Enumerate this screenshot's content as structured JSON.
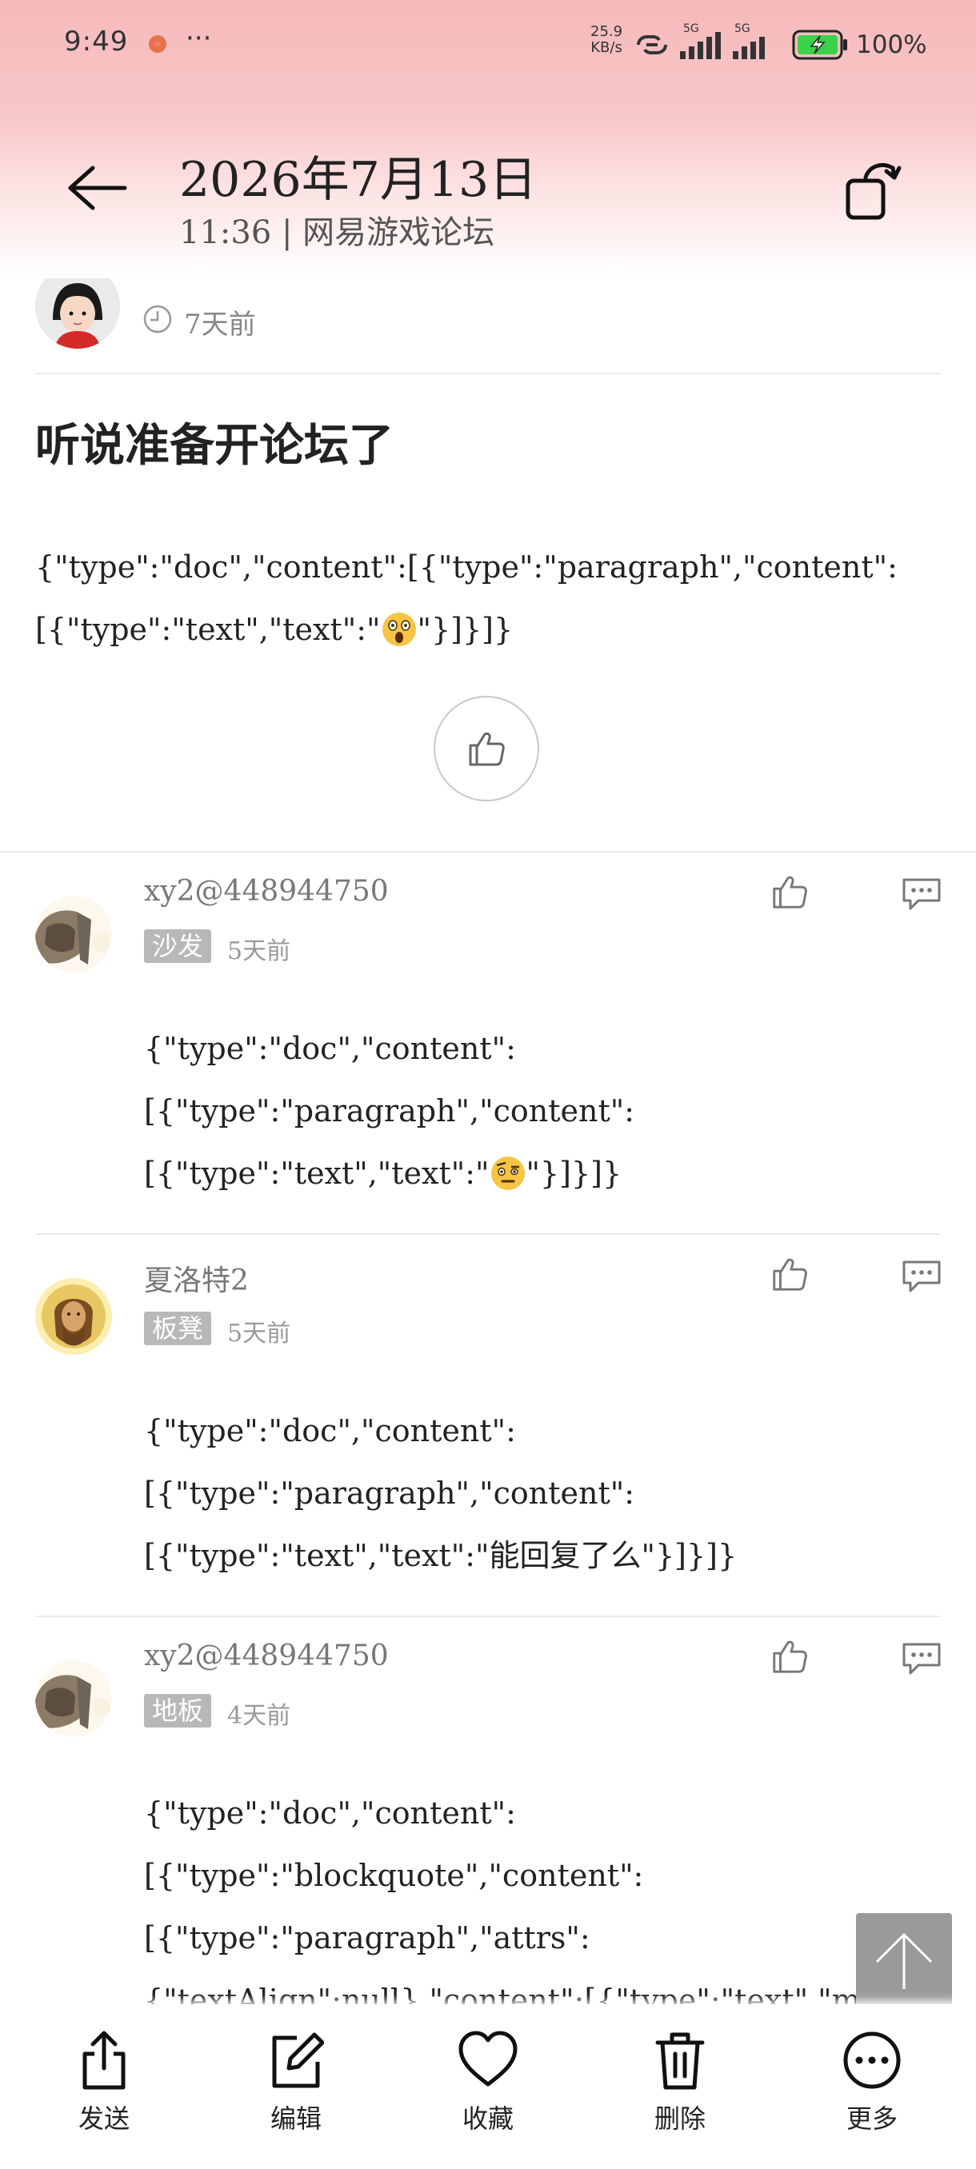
{
  "status_bar": {
    "time": "9:49",
    "dots": "···",
    "net_speed_value": "25.9",
    "net_speed_unit": "KB/s",
    "signal_1": "5G",
    "signal_2": "5G",
    "battery": "100%"
  },
  "header": {
    "date": "2026年7月13日",
    "subtitle": "11:36 | 网易游戏论坛",
    "back_icon": "arrow-left-icon",
    "rotate_icon": "rotate-screen-icon"
  },
  "post": {
    "time_ago": "7天前",
    "title": "听说准备开论坛了",
    "body_line_1": "{\"type\":\"doc\",\"content\":[{\"type\":\"paragraph\",\"content\":",
    "body_line_2_prefix": "[{\"type\":\"text\",\"text\":\"",
    "body_line_2_suffix": "\"}]}]}",
    "emoji": "astonished-face"
  },
  "replies": [
    {
      "user": "xy2@448944750",
      "floor": "沙发",
      "time_ago": "5天前",
      "lines": [
        "{\"type\":\"doc\",\"content\":",
        "[{\"type\":\"paragraph\",\"content\":",
        "[{\"type\":\"text\",\"text\":\""
      ],
      "line3_suffix": "\"}]}]}",
      "emoji": "face-with-raised-eyebrow"
    },
    {
      "user": "夏洛特2",
      "floor": "板凳",
      "time_ago": "5天前",
      "lines": [
        "{\"type\":\"doc\",\"content\":",
        "[{\"type\":\"paragraph\",\"content\":",
        "[{\"type\":\"text\",\"text\":\"能回复了么\"}]}]}"
      ]
    },
    {
      "user": "xy2@448944750",
      "floor": "地板",
      "time_ago": "4天前",
      "lines": [
        "{\"type\":\"doc\",\"content\":",
        "[{\"type\":\"blockquote\",\"content\":",
        "[{\"type\":\"paragraph\",\"attrs\":",
        "{\"textAlign\":null},\"content\":[{\"type\":\"text\",\"marks\":"
      ]
    }
  ],
  "bottom_bar": {
    "send": "发送",
    "edit": "编辑",
    "favorite": "收藏",
    "delete": "删除",
    "more": "更多"
  },
  "colors": {
    "header_top": "#f6b9bb",
    "badge_bg": "#b8b8b8",
    "scroll_top_bg": "#9a9a9a",
    "battery_green": "#3bd14b"
  }
}
